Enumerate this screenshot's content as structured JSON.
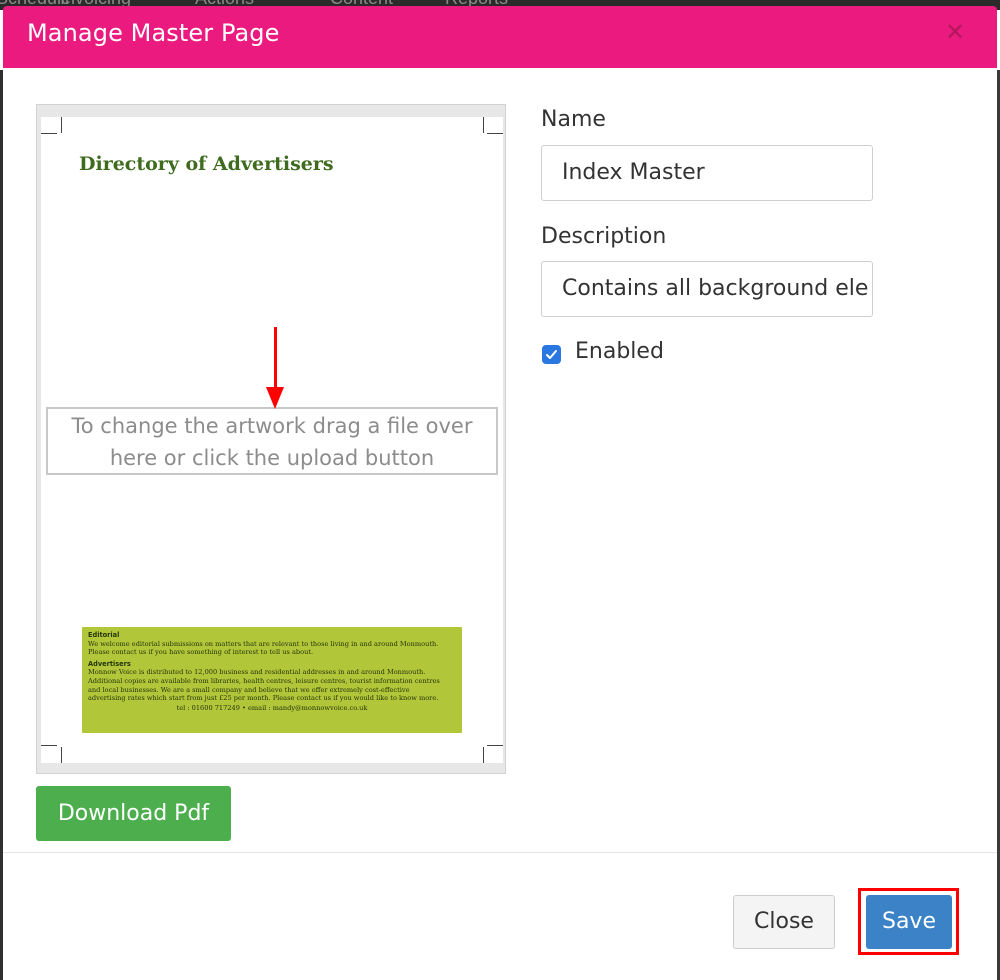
{
  "modal": {
    "title": "Manage Master Page",
    "close_icon": "close-icon"
  },
  "background_menu": [
    "Schedule",
    "Invoicing",
    "Actions",
    "Content",
    "Reports"
  ],
  "preview": {
    "heading": "Directory of Advertisers",
    "drop_hint_line1": "To change the artwork drag a file over",
    "drop_hint_line2": "here or click the upload button",
    "info_box": {
      "editorial_title": "Editorial",
      "editorial_line1": "We welcome editorial submissions on matters that are relevant to those living in and around Monmouth.",
      "editorial_line2": "Please contact us if you have something of interest to tell us about.",
      "advertisers_title": "Advertisers",
      "advertisers_line1": "Monnow Voice is distributed to 12,000 business and residential addresses in and around Monmouth.",
      "advertisers_line2": "Additional copies are available from libraries, health centres, leisure centres, tourist information centres",
      "advertisers_line3": "and local businesses. We are a small company and believe that we offer extremely cost-effective",
      "advertisers_line4": "advertising rates which start from just £25 per month.  Please contact us if you would like to know more.",
      "contact": "tel : 01600 717249 • email :  mandy@monnowvoice.co.uk"
    },
    "download_label": "Download Pdf"
  },
  "form": {
    "name_label": "Name",
    "name_value": "Index Master",
    "description_label": "Description",
    "description_value": "Contains all background ele",
    "enabled_label": "Enabled",
    "enabled_checked": true
  },
  "footer": {
    "close_label": "Close",
    "save_label": "Save"
  },
  "colors": {
    "header": "#ea1a7f",
    "download_button": "#4cae4c",
    "save_button": "#3b82c6",
    "annotation": "#ff0000",
    "info_box": "#b2c63a",
    "heading_green": "#3f6b1f"
  }
}
